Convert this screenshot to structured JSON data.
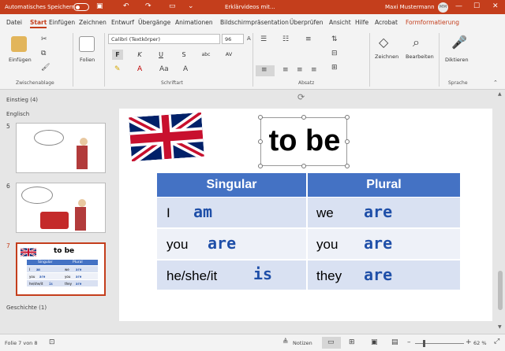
{
  "titlebar": {
    "autosave_label": "Automatisches Speichern",
    "doc_title": "Erklärvideos mit...",
    "user_name": "Maxi Mustermann",
    "user_initials": "MM"
  },
  "tabs": [
    {
      "label": "Datei"
    },
    {
      "label": "Start"
    },
    {
      "label": "Einfügen"
    },
    {
      "label": "Zeichnen"
    },
    {
      "label": "Entwurf"
    },
    {
      "label": "Übergänge"
    },
    {
      "label": "Animationen"
    },
    {
      "label": "Bildschirmpräsentation"
    },
    {
      "label": "Überprüfen"
    },
    {
      "label": "Ansicht"
    },
    {
      "label": "Hilfe"
    },
    {
      "label": "Acrobat"
    },
    {
      "label": "Formformatierung"
    }
  ],
  "ribbon": {
    "paste_label": "Einfügen",
    "clipboard_group": "Zwischenablage",
    "slides_label": "Folien",
    "font_name": "Calibri (Textkörper)",
    "font_size": "96",
    "font_group": "Schriftart",
    "bold": "F",
    "italic": "K",
    "underline": "U",
    "strike": "S",
    "char_spacing": "AV",
    "paragraph_group": "Absatz",
    "drawing_label": "Zeichnen",
    "editing_label": "Bearbeiten",
    "dictate_label": "Diktieren",
    "voice_group": "Sprache"
  },
  "panel": {
    "section1": "Einstieg (4)",
    "section2": "Englisch",
    "section3": "Geschichte (1)",
    "slide_numbers": [
      "5",
      "6",
      "7"
    ],
    "mini_title": "to be",
    "mini_sing": "Singular",
    "mini_plural": "Plural"
  },
  "slide": {
    "title": "to be",
    "header_singular": "Singular",
    "header_plural": "Plural",
    "rows": [
      {
        "s_pronoun": "I",
        "s_verb": "am",
        "p_pronoun": "we",
        "p_verb": "are"
      },
      {
        "s_pronoun": "you",
        "s_verb": "are",
        "p_pronoun": "you",
        "p_verb": "are"
      },
      {
        "s_pronoun": "he/she/it",
        "s_verb": "is",
        "p_pronoun": "they",
        "p_verb": "are"
      }
    ]
  },
  "status": {
    "slide_info": "Folie 7 von 8",
    "notes": "Notizen",
    "zoom": "62 %"
  },
  "colors": {
    "accent": "#c43e1c",
    "table_header": "#4472c4",
    "table_row": "#d9e1f2",
    "handwriting": "#1f4fa8"
  }
}
